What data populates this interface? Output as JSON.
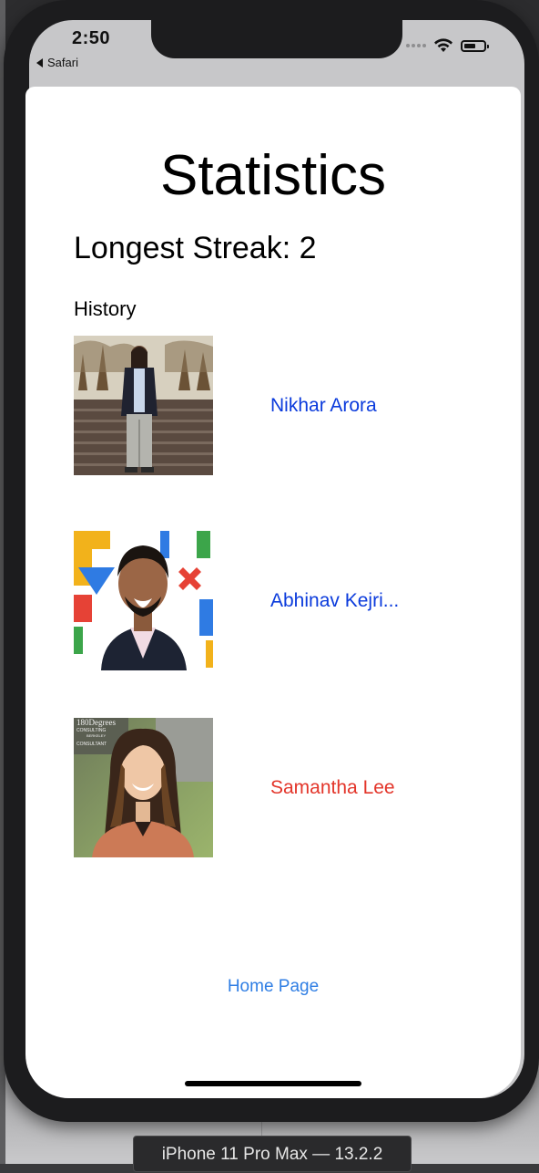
{
  "status_bar": {
    "time": "2:50",
    "back_app": "Safari"
  },
  "page": {
    "title": "Statistics",
    "streak": "Longest Streak: 2",
    "history_label": "History",
    "home_link": "Home Page"
  },
  "history": [
    {
      "name": "Nikhar Arora",
      "color": "#0b3bdc"
    },
    {
      "name": "Abhinav Kejri...",
      "color": "#0b3bdc"
    },
    {
      "name": "Samantha Lee",
      "color": "#e3352a"
    }
  ],
  "photo_text": {
    "logo_line1": "180Degrees",
    "logo_line2": "CONSULTING",
    "logo_line3": "BERKELEY",
    "logo_line4": "CONSULTANT"
  },
  "device_label": "iPhone 11 Pro Max — 13.2.2"
}
